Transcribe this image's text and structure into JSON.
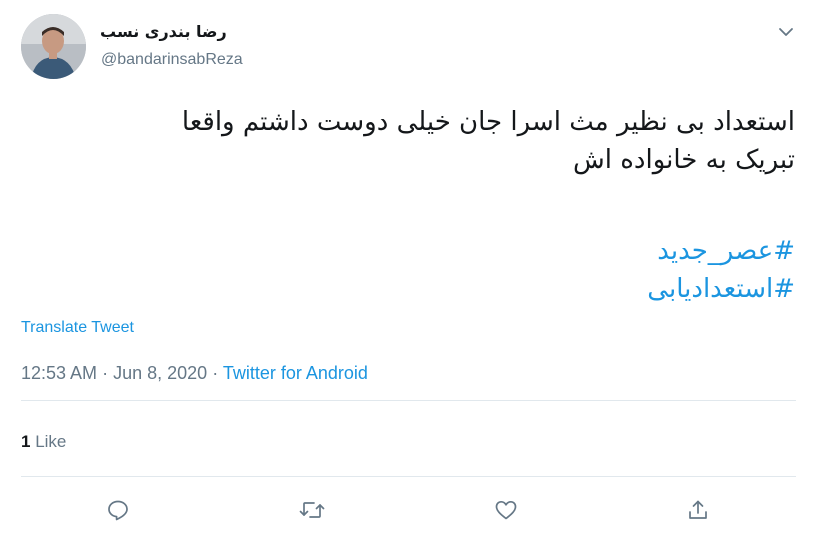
{
  "user": {
    "display_name": "رضا بندری نسب",
    "handle": "@bandarinsabReza"
  },
  "tweet": {
    "text_line1": "استعداد بی نظیر مث اسرا جان خیلی دوست داشتم واقعا",
    "text_line2": "تبریک به خانواده اش",
    "hashtags": [
      "#عصر_جدید",
      "#استعدادیابی"
    ]
  },
  "translate_label": "Translate Tweet",
  "meta": {
    "time": "12:53 AM",
    "separator": "·",
    "date": "Jun 8, 2020",
    "source": "Twitter for Android"
  },
  "stats": {
    "likes_count": "1",
    "likes_label": "Like"
  },
  "actions": {
    "icons": [
      "reply-icon",
      "retweet-icon",
      "like-icon",
      "share-icon"
    ]
  },
  "colors": {
    "link": "#1b95e0",
    "muted": "#657786",
    "text": "#14171a",
    "divider": "#e1e8ed"
  }
}
